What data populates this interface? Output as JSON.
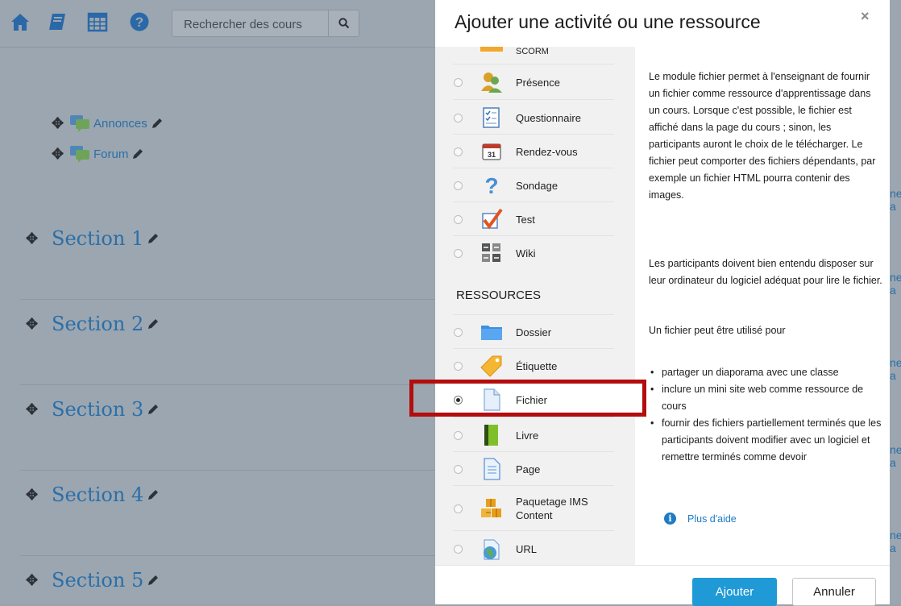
{
  "search": {
    "placeholder": "Rechercher des cours"
  },
  "course": {
    "activities": [
      "Annonces",
      "Forum"
    ],
    "sections": [
      "Section 1",
      "Section 2",
      "Section 3",
      "Section 4",
      "Section 5"
    ],
    "edge_text": "ne a"
  },
  "modal": {
    "title": "Ajouter une activité ou une ressource",
    "close": "×",
    "partial_item": "SCORM",
    "activities": [
      {
        "label": "Présence",
        "icon": "attendance-icon"
      },
      {
        "label": "Questionnaire",
        "icon": "questionnaire-icon"
      },
      {
        "label": "Rendez-vous",
        "icon": "calendar-icon"
      },
      {
        "label": "Sondage",
        "icon": "question-mark-icon"
      },
      {
        "label": "Test",
        "icon": "checkmark-icon"
      },
      {
        "label": "Wiki",
        "icon": "wiki-icon"
      }
    ],
    "resources_heading": "RESSOURCES",
    "resources": [
      {
        "label": "Dossier",
        "icon": "folder-icon"
      },
      {
        "label": "Étiquette",
        "icon": "tag-icon"
      },
      {
        "label": "Fichier",
        "icon": "file-icon",
        "selected": true
      },
      {
        "label": "Livre",
        "icon": "book-icon"
      },
      {
        "label": "Page",
        "icon": "page-icon"
      },
      {
        "label": "Paquetage IMS Content",
        "icon": "package-icon"
      },
      {
        "label": "URL",
        "icon": "url-icon"
      }
    ],
    "description": {
      "p1": "Le module fichier permet à l'enseignant de fournir un fichier comme ressource d'apprentissage dans un cours. Lorsque c'est possible, le fichier est affiché dans la page du cours ; sinon, les participants auront le choix de le télécharger. Le fichier peut comporter des fichiers dépendants, par exemple un fichier HTML pourra contenir des images.",
      "p2": "Les participants doivent bien entendu disposer sur leur ordinateur du logiciel adéquat pour lire le fichier.",
      "p3": "Un fichier peut être utilisé pour",
      "bullets": [
        "partager un diaporama avec une classe",
        "inclure un mini site web comme ressource de cours",
        "fournir des fichiers partiellement terminés que les participants doivent modifier avec un logiciel et remettre terminés comme devoir"
      ],
      "help": "Plus d'aide"
    },
    "buttons": {
      "add": "Ajouter",
      "cancel": "Annuler"
    }
  },
  "colors": {
    "accent": "#1f9ad6",
    "highlight": "#b30d0d",
    "link": "#2a6fa8"
  }
}
